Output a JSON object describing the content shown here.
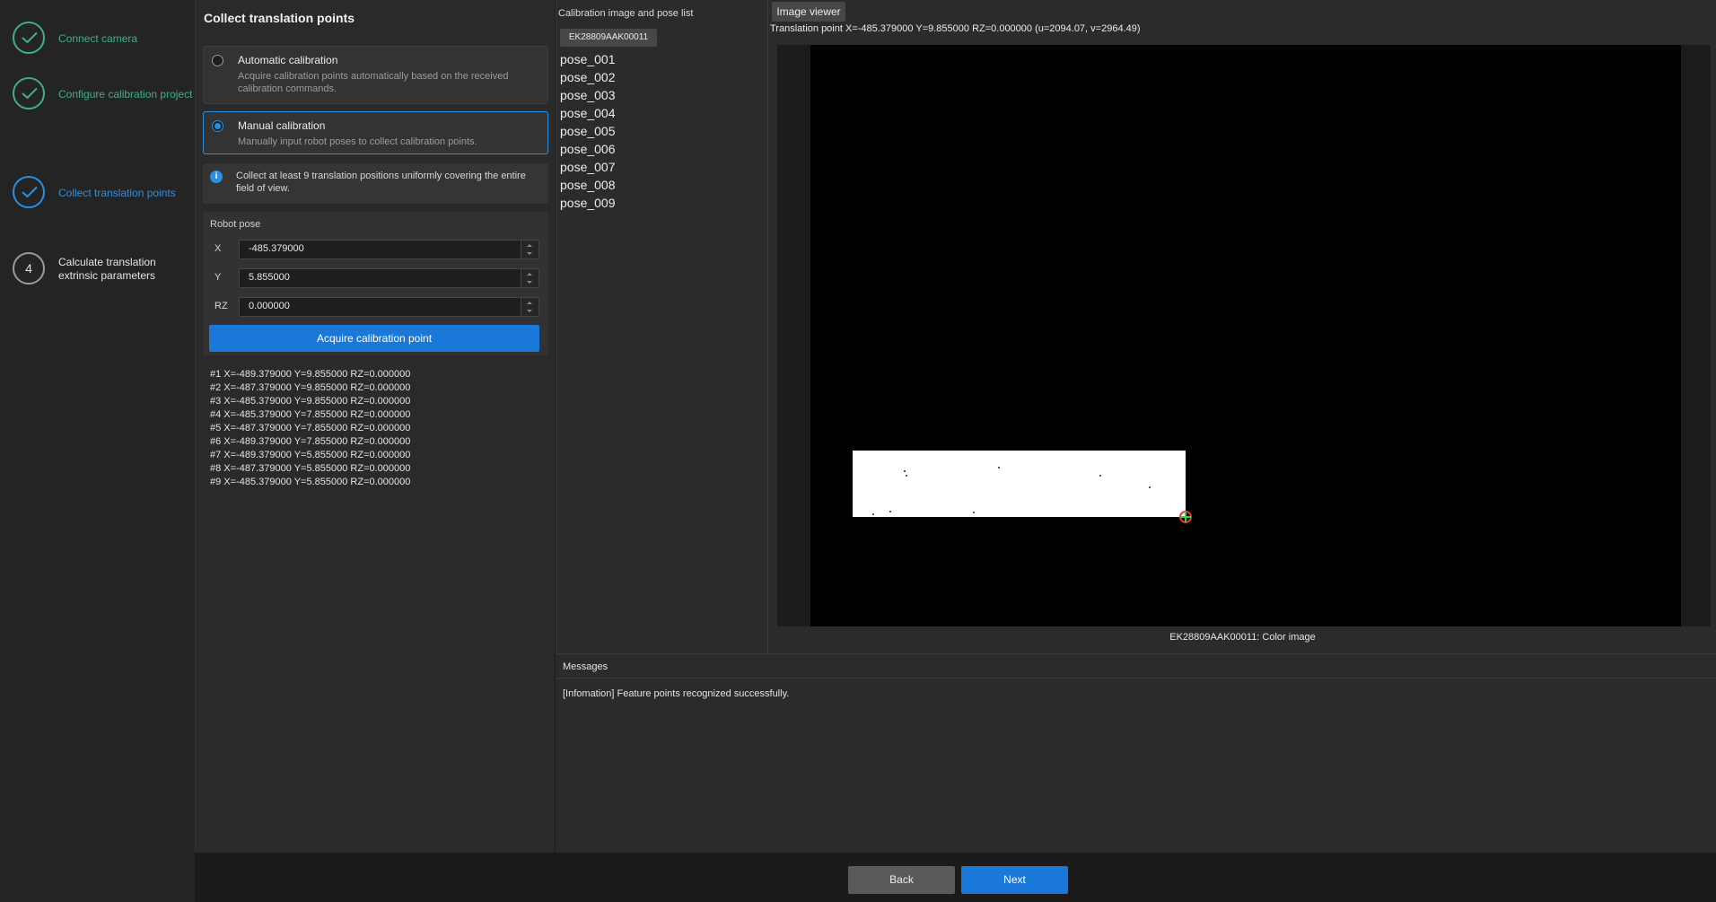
{
  "steps": [
    {
      "label": "Connect camera",
      "state": "done"
    },
    {
      "label": "Configure calibration project",
      "state": "done"
    },
    {
      "label": "Collect translation points",
      "state": "active"
    },
    {
      "label": "Calculate translation extrinsic parameters",
      "state": "todo",
      "number": "4"
    }
  ],
  "config": {
    "title": "Collect translation points",
    "auto": {
      "title": "Automatic calibration",
      "desc": "Acquire calibration points automatically based on the received calibration commands."
    },
    "manual": {
      "title": "Manual calibration",
      "desc": "Manually input robot poses to collect calibration points."
    },
    "info": "Collect at least 9 translation positions uniformly covering the entire field of view.",
    "robot_pose": {
      "title": "Robot pose",
      "x_label": "X",
      "x_value": "-485.379000",
      "y_label": "Y",
      "y_value": "5.855000",
      "rz_label": "RZ",
      "rz_value": "0.000000"
    },
    "acquire_label": "Acquire calibration point",
    "points": [
      "#1  X=-489.379000  Y=9.855000  RZ=0.000000",
      "#2  X=-487.379000  Y=9.855000  RZ=0.000000",
      "#3  X=-485.379000  Y=9.855000  RZ=0.000000",
      "#4  X=-485.379000  Y=7.855000  RZ=0.000000",
      "#5  X=-487.379000  Y=7.855000  RZ=0.000000",
      "#6  X=-489.379000  Y=7.855000  RZ=0.000000",
      "#7  X=-489.379000  Y=5.855000  RZ=0.000000",
      "#8  X=-487.379000  Y=5.855000  RZ=0.000000",
      "#9  X=-485.379000  Y=5.855000  RZ=0.000000"
    ]
  },
  "pose_list": {
    "title": "Calibration image and pose list",
    "camera": "EK28809AAK00011",
    "poses": [
      "pose_001",
      "pose_002",
      "pose_003",
      "pose_004",
      "pose_005",
      "pose_006",
      "pose_007",
      "pose_008",
      "pose_009"
    ]
  },
  "viewer": {
    "tab": "Image viewer",
    "readout": "Translation point  X=-485.379000  Y=9.855000  RZ=0.000000  (u=2094.07, v=2964.49)",
    "caption": "EK28809AAK00011: Color image"
  },
  "messages": {
    "title": "Messages",
    "line": "[Infomation] Feature points recognized successfully."
  },
  "nav": {
    "back": "Back",
    "next": "Next"
  },
  "colors": {
    "accent": "#1a78d8",
    "done": "#3fae8a",
    "active": "#2b8fe0"
  }
}
